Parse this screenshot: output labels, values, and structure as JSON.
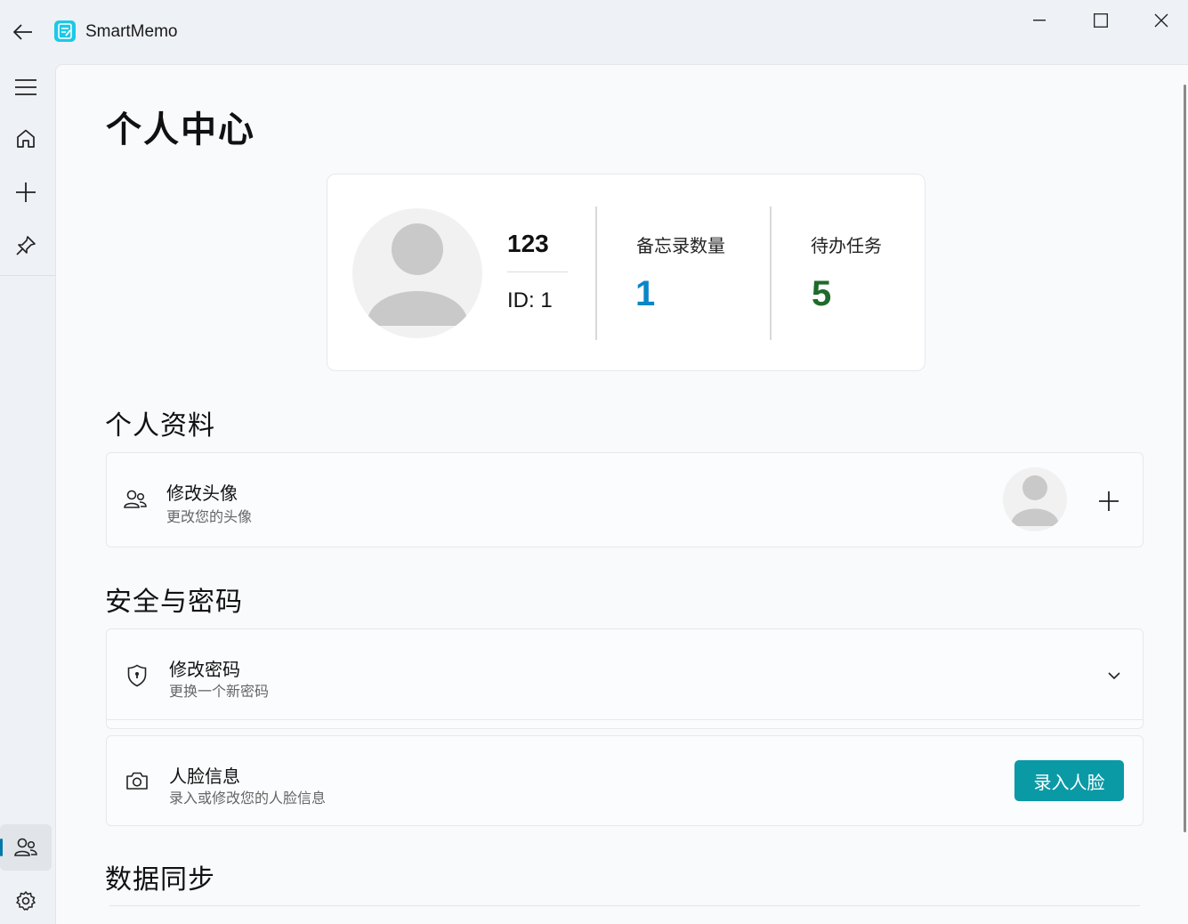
{
  "app": {
    "title": "SmartMemo"
  },
  "page": {
    "title": "个人中心"
  },
  "profile": {
    "name": "123",
    "id_text": "ID: 1",
    "stats": [
      {
        "label": "备忘录数量",
        "value": "1",
        "color": "#0a86c8"
      },
      {
        "label": "待办任务",
        "value": "5",
        "color": "#1f6b2a"
      }
    ]
  },
  "sections": {
    "personal": {
      "title": "个人资料",
      "avatar_setting": {
        "title": "修改头像",
        "subtitle": "更改您的头像"
      }
    },
    "security": {
      "title": "安全与密码",
      "password_setting": {
        "title": "修改密码",
        "subtitle": "更换一个新密码"
      },
      "face_setting": {
        "title": "人脸信息",
        "subtitle": "录入或修改您的人脸信息",
        "button_label": "录入人脸"
      }
    },
    "sync": {
      "title": "数据同步"
    }
  },
  "colors": {
    "accent": "#0a9aa6",
    "memo_count": "#0a86c8",
    "todo_count": "#1f6b2a"
  }
}
